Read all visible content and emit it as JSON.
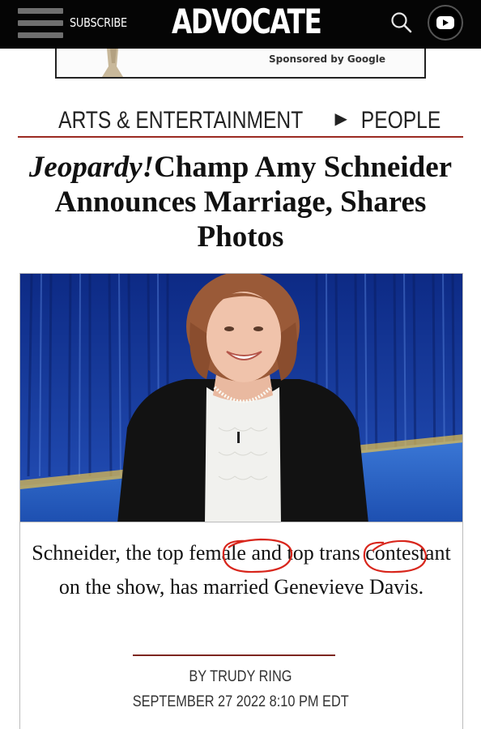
{
  "header": {
    "subscribe_label": "SUBSCRIBE",
    "logo_text": "ADVOCATE",
    "menu_icon": "hamburger-menu-icon",
    "search_icon": "search-icon",
    "youtube_icon": "youtube-icon"
  },
  "ad": {
    "sponsor_text": "Sponsored by Google"
  },
  "breadcrumb": {
    "section": "ARTS & ENTERTAINMENT",
    "separator": "▶",
    "subsection": "PEOPLE"
  },
  "article": {
    "headline_italic": "Jeopardy!",
    "headline_rest": "Champ Amy Schneider Announces Marriage, Shares Photos",
    "caption_part1": "Schneider, the top ",
    "caption_circled1": "female",
    "caption_part2": " and top ",
    "caption_circled2": "trans",
    "caption_part3": " contestant on the show, has married Genevieve Davis.",
    "byline": "BY TRUDY RING",
    "dateline": "SEPTEMBER 27 2022 8:10 PM EDT"
  },
  "colors": {
    "header_bg": "#050505",
    "accent_red": "#9b2a22",
    "annotation_red": "#d8261c",
    "curtain_blue": "#1c3fa0"
  }
}
